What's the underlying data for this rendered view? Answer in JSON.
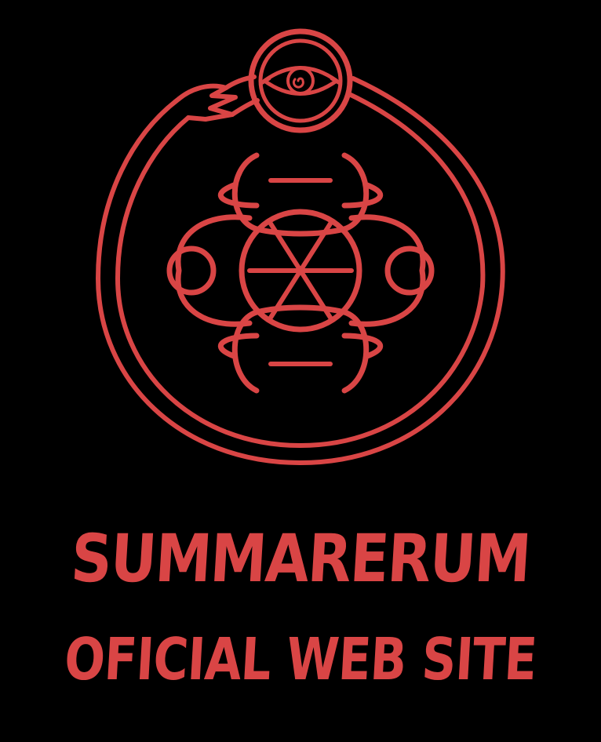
{
  "brand": {
    "name": "SUMMARERUM",
    "tagline": "OFICIAL WEB SITE"
  },
  "colors": {
    "background": "#000000",
    "accent": "#d94545"
  },
  "emblem": {
    "icon": "ouroboros-sigil-icon",
    "parts": [
      "ouroboros-ring",
      "eye",
      "crescents",
      "circles",
      "asterisk"
    ]
  }
}
